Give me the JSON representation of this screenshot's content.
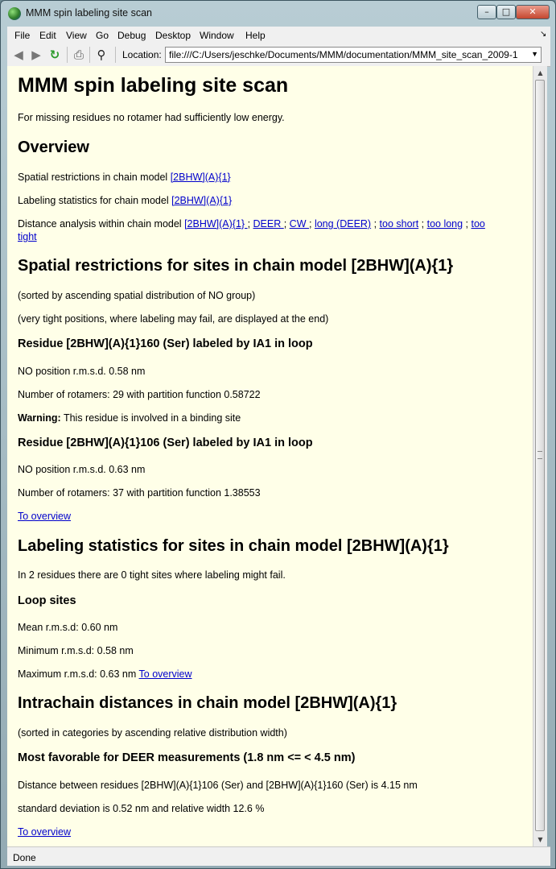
{
  "window": {
    "title": "MMM spin labeling site scan",
    "close_glyph": "✕",
    "min_glyph": "–",
    "max_glyph": "□"
  },
  "menu": [
    "File",
    "Edit",
    "View",
    "Go",
    "Debug",
    "Desktop",
    "Window",
    "Help"
  ],
  "toolbar": {
    "location_label": "Location:",
    "url": "file:///C:/Users/jeschke/Documents/MMM/documentation/MMM_site_scan_2009-1"
  },
  "page": {
    "title": "MMM spin labeling site scan",
    "intro": "For missing residues no rotamer had sufficiently low energy.",
    "overview_heading": "Overview",
    "ov1_text": "Spatial restrictions in chain model",
    "ov1_link": "[2BHW](A){1}",
    "ov2_text": "Labeling statistics for chain model",
    "ov2_link": "[2BHW](A){1}",
    "ov3_text": "Distance analysis within chain model",
    "ov3_links": [
      "[2BHW](A){1} ",
      "DEER ",
      "CW ",
      "long (DEER)",
      "too short",
      "too long",
      "too"
    ],
    "ov3_sep": " ; ",
    "ov3_wrap": "tight",
    "sr_heading": "Spatial restrictions for sites in chain model [2BHW](A){1}",
    "sr_note1": "(sorted by ascending spatial distribution of NO group)",
    "sr_note2": "(very tight positions, where labeling may fail, are displayed at the end)",
    "res1_heading": "Residue [2BHW](A){1}160 (Ser) labeled by IA1 in loop",
    "res1_rmsd": "NO position r.m.s.d. 0.58 nm",
    "res1_rot": "Number of rotamers: 29 with partition function 0.58722",
    "res1_warn_label": "Warning:",
    "res1_warn_text": " This residue is involved in a binding site",
    "res2_heading": "Residue [2BHW](A){1}106 (Ser) labeled by IA1 in loop",
    "res2_rmsd": "NO position r.m.s.d. 0.63 nm",
    "res2_rot": "Number of rotamers: 37 with partition function 1.38553",
    "to_overview": "To overview",
    "ls_heading": "Labeling statistics for sites in chain model [2BHW](A){1}",
    "ls_text": "In 2 residues there are 0 tight sites where labeling might fail.",
    "loop_heading": "Loop sites",
    "mean": "Mean r.m.s.d: 0.60 nm",
    "min": "Minimum r.m.s.d: 0.58 nm",
    "max": "Maximum r.m.s.d: 0.63 nm",
    "id_heading": "Intrachain distances in chain model [2BHW](A){1}",
    "id_note": "(sorted in categories by ascending relative distribution width)",
    "deer_heading": "Most favorable for DEER measurements (1.8 nm <= < 4.5 nm)",
    "dist_text": "Distance between residues [2BHW](A){1}106 (Ser) and [2BHW](A){1}160 (Ser) is 4.15 nm",
    "std_text": "standard deviation is 0.52 nm and relative width 12.6 %"
  },
  "status": "Done"
}
